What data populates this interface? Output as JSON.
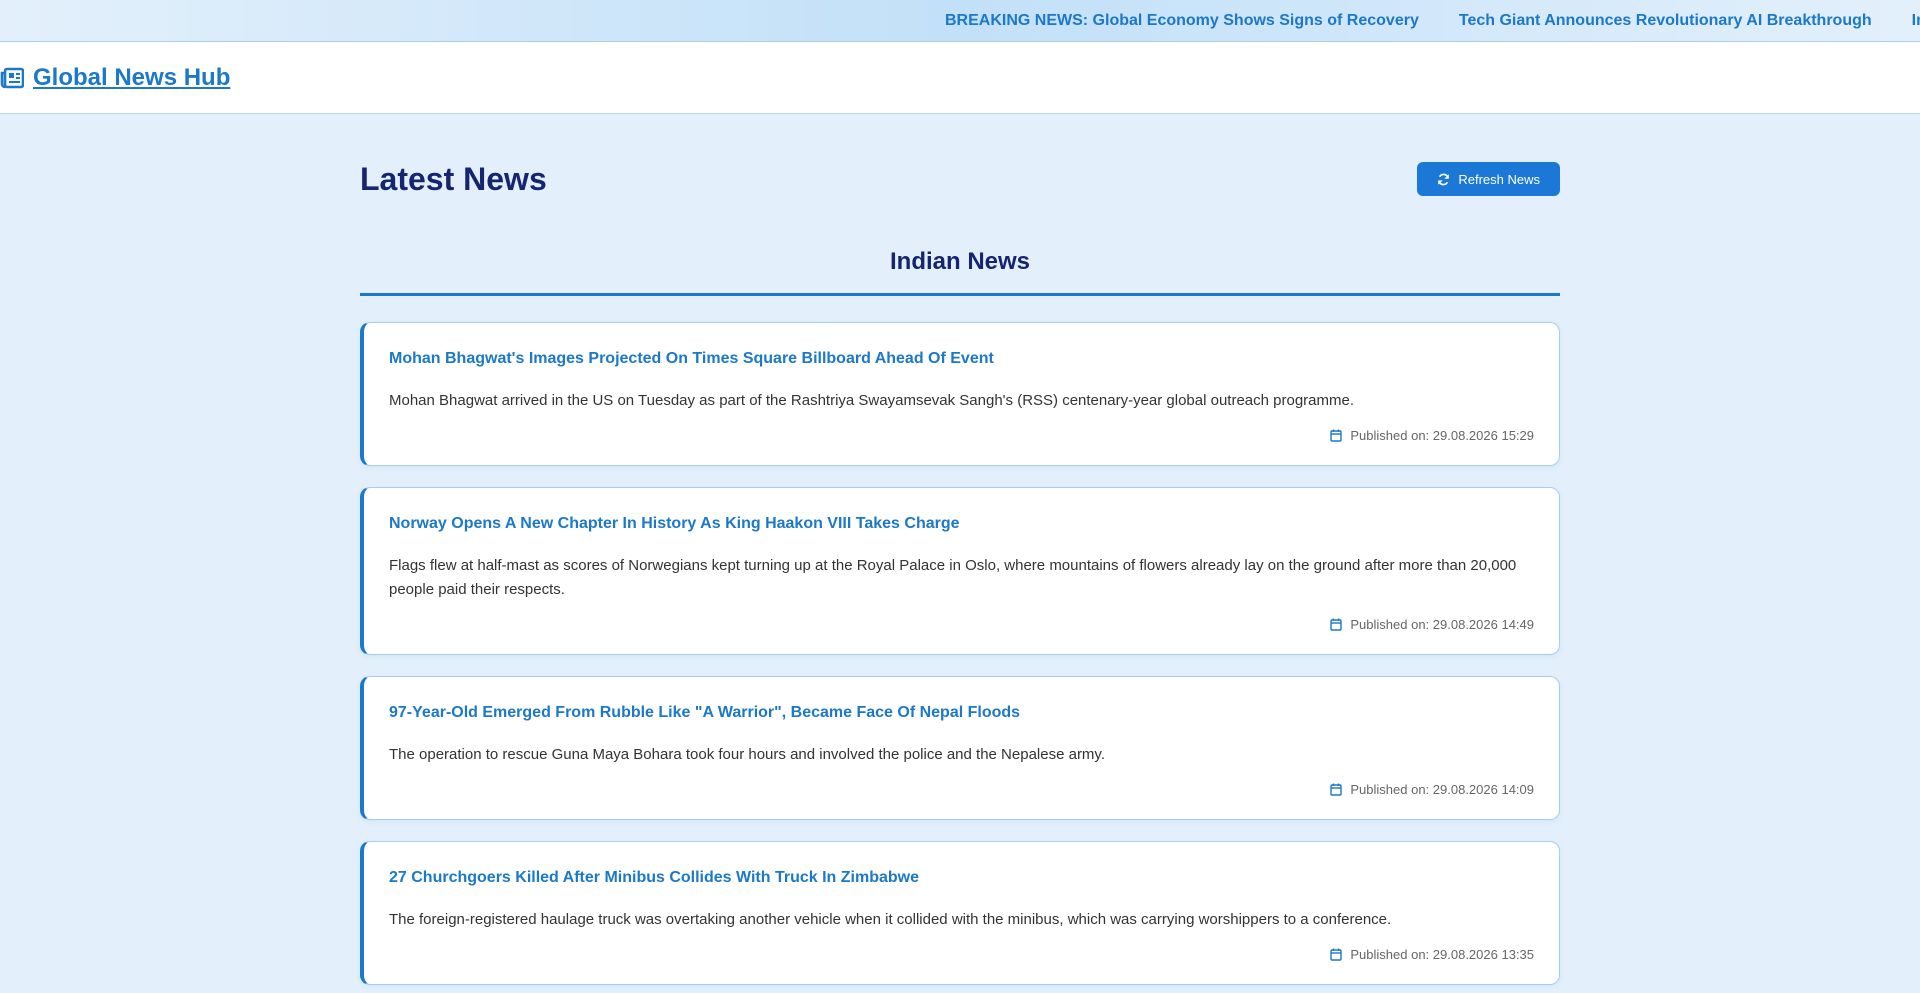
{
  "ticker": {
    "items": [
      "BREAKING NEWS: Global Economy Shows Signs of Recovery",
      "Tech Giant Announces Revolutionary AI Breakthrough",
      "In"
    ]
  },
  "nav": {
    "brand": "Global News Hub",
    "brand_icon": "newspaper-icon"
  },
  "main": {
    "title": "Latest News",
    "refresh_label": "Refresh News",
    "refresh_icon": "refresh-icon",
    "section_title": "Indian News",
    "date_prefix": "Published on:",
    "articles": [
      {
        "title": "Mohan Bhagwat's Images Projected On Times Square Billboard Ahead Of Event",
        "description": "Mohan Bhagwat arrived in the US on Tuesday as part of the Rashtriya Swayamsevak Sangh's (RSS) centenary-year global outreach programme.",
        "published": "Published on: 29.08.2026 15:29"
      },
      {
        "title": "Norway Opens A New Chapter In History As King Haakon VIII Takes Charge",
        "description": "Flags flew at half-mast as scores of Norwegians kept turning up at the Royal Palace in Oslo, where mountains of flowers already lay on the ground after more than 20,000 people paid their respects.",
        "published": "Published on: 29.08.2026 14:49"
      },
      {
        "title": "97-Year-Old Emerged From Rubble Like \"A Warrior\", Became Face Of Nepal Floods",
        "description": "The operation to rescue Guna Maya Bohara took four hours and involved the police and the Nepalese army.",
        "published": "Published on: 29.08.2026 14:09"
      },
      {
        "title": "27 Churchgoers Killed After Minibus Collides With Truck In Zimbabwe",
        "description": "The foreign-registered haulage truck was overtaking another vehicle when it collided with the minibus, which was carrying worshippers to a conference.",
        "published": "Published on: 29.08.2026 13:35"
      }
    ]
  },
  "colors": {
    "accent": "#1c78c8",
    "heading": "#15256f",
    "background": "#e3f0fb",
    "button": "#1c78d6"
  }
}
